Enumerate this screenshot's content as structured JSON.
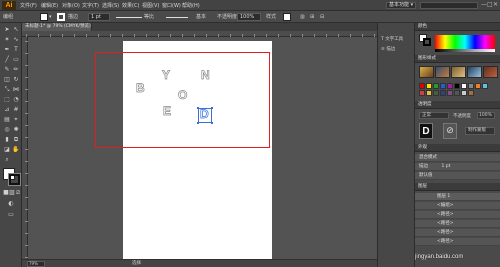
{
  "app": {
    "logo": "Ai",
    "menu": [
      "文件(F)",
      "编辑(E)",
      "对象(O)",
      "文字(T)",
      "选择(S)",
      "效果(C)",
      "视图(V)",
      "窗口(W)",
      "帮助(H)"
    ],
    "workspace": "基本功能 ▾",
    "window_controls": [
      "—",
      "□",
      "✕"
    ]
  },
  "controlbar": {
    "label": "编组",
    "stroke_label": "描边",
    "stroke_value": "1 pt",
    "uniform_label": "等比",
    "style_label": "基本",
    "opacity_label": "不透明度",
    "opacity_value": "100%",
    "style2_label": "样式"
  },
  "document": {
    "tab_title": "未标题-1* @ 79% (CMYK/预览)",
    "close": "×",
    "letters": [
      "B",
      "Y",
      "O",
      "N",
      "E",
      "D"
    ],
    "zoom": "79%",
    "status": "选择"
  },
  "dock": {
    "items": [
      {
        "label": "文字工具",
        "icon": "text-tool-icon"
      },
      {
        "label": "描边",
        "icon": "stroke-icon"
      }
    ]
  },
  "panels": {
    "color_title": "颜色",
    "graphic_styles_title": "图形样式",
    "appearance_title": "外观",
    "transparency_title": "透明度",
    "normal_label": "正常",
    "opacity_label": "不透明度",
    "opacity_value": "100%",
    "make_mask": "制作蒙版",
    "appearance_group": "混合模式",
    "stroke_item": "描边",
    "stroke_value": "1 pt",
    "opacity_item": "默认值",
    "layers_title": "图层",
    "layer_name": "图层 1",
    "layer_rows": [
      "<编组>",
      "<路径>",
      "<路径>",
      "<路径>",
      "<路径>"
    ]
  },
  "colors": {
    "accent": "#ff9a00",
    "selection": "#3a6fd8",
    "highlight": "#e02020"
  },
  "watermark": "jingyan.baidu.com"
}
